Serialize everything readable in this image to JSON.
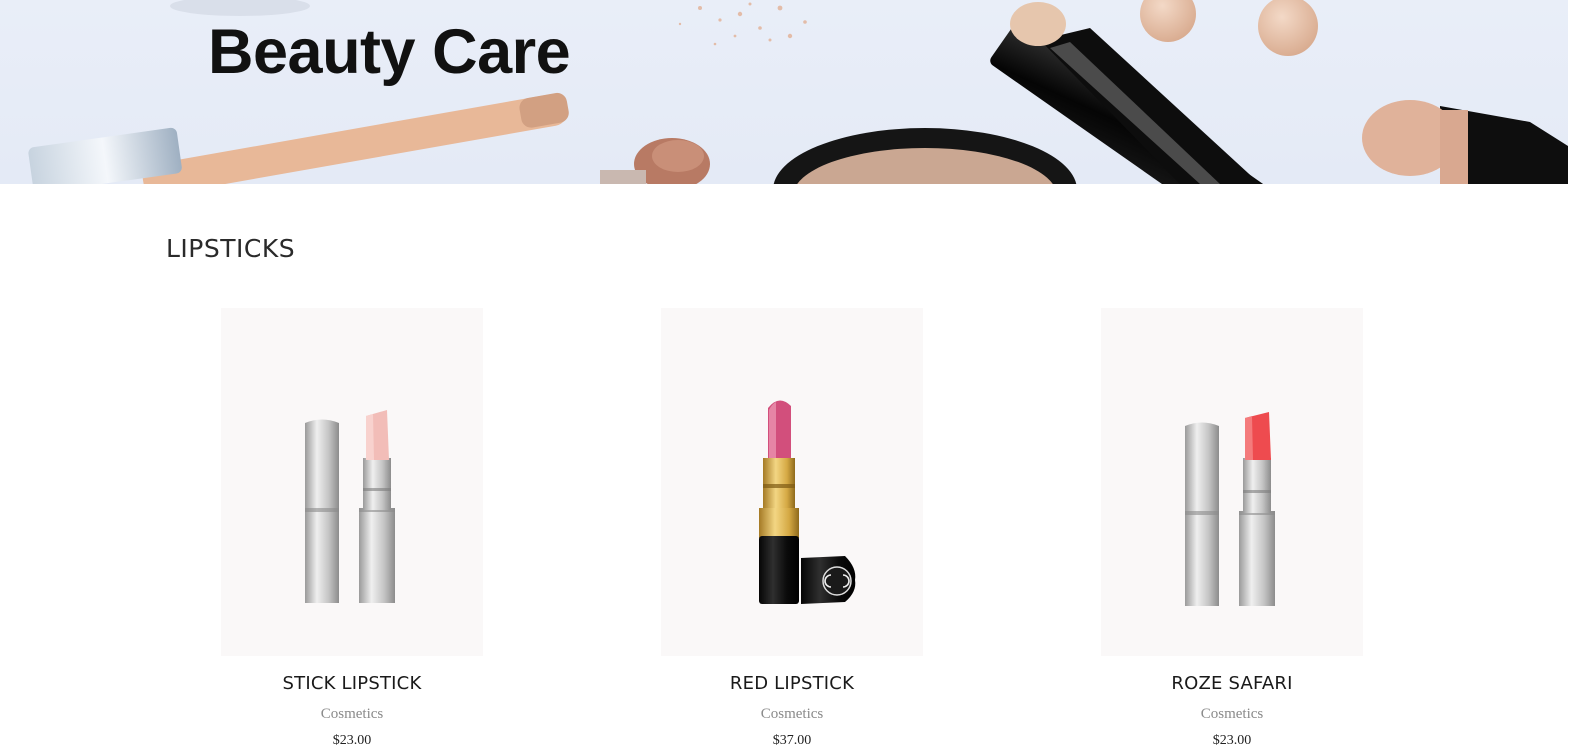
{
  "hero": {
    "title": "Beauty Care"
  },
  "section": {
    "title": "LIPSTICKS"
  },
  "products": [
    {
      "name": "STICK LIPSTICK",
      "category": "Cosmetics",
      "price": "$23.00",
      "image": "silver-lipstick-nude-icon",
      "bullet_color": "#f2bdb8"
    },
    {
      "name": "RED LIPSTICK",
      "category": "Cosmetics",
      "price": "$37.00",
      "image": "black-gold-lipstick-icon",
      "bullet_color": "#d24f7c"
    },
    {
      "name": "ROZE SAFARI",
      "category": "Cosmetics",
      "price": "$23.00",
      "image": "silver-lipstick-coral-icon",
      "bullet_color": "#ee4b4f"
    }
  ]
}
